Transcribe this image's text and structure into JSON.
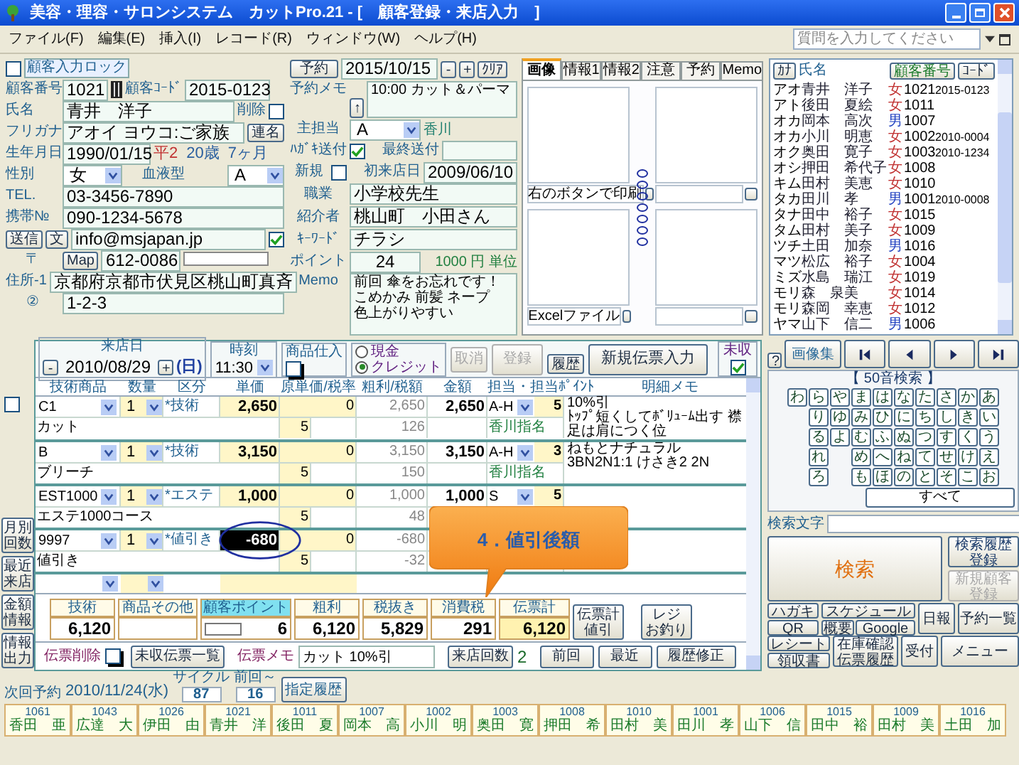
{
  "window": {
    "title": "美容・理容・サロンシステム　カットPro.21 - [　顧客登録・来店入力　]"
  },
  "menu": [
    "ファイル(F)",
    "編集(E)",
    "挿入(I)",
    "レコード(R)",
    "ウィンドウ(W)",
    "ヘルプ(H)"
  ],
  "help_search": {
    "placeholder": "質問を入力してください"
  },
  "customer": {
    "lock": {
      "label": "顧客入力ロック",
      "checked": false
    },
    "number_label": "顧客番号",
    "number": "1021",
    "code_label": "顧客ｺｰﾄﾞ",
    "code": "2015-0123",
    "name_label": "氏名",
    "name": "青井　洋子",
    "delete_label": "削除",
    "deleted": false,
    "kana_label": "フリガナ",
    "kana": "アオイ ヨウコ:ご家族",
    "joint_button": "連名",
    "birth_label": "生年月日",
    "birth": "1990/01/15",
    "era": "平2",
    "age": "20歳",
    "months": "7ヶ月",
    "sex_label": "性別",
    "sex": "女",
    "blood_label": "血液型",
    "blood": "A",
    "tel_label": "TEL.",
    "tel": "03-3456-7890",
    "mobile_label": "携帯№",
    "mobile": "090-1234-5678",
    "send_button": "送信",
    "text_button": "文",
    "email": "info@msjapan.jp",
    "email_ok": true,
    "zip_label": "〒",
    "map_button": "Map",
    "zip": "612-0086",
    "address1_label": "住所-1",
    "address1": "京都府京都市伏見区桃山町真斉",
    "address2_label": "②",
    "address2": "1-2-3"
  },
  "reservation": {
    "button": "予約",
    "date": "2015/10/15",
    "minus": "-",
    "plus": "+",
    "clear": "ｸﾘｱ",
    "memo_label": "予約メモ",
    "up_button": "↑",
    "memo": "10:00 カット＆パーマ"
  },
  "profile": {
    "staff_label": "主担当",
    "staff": "A",
    "staff_name": "香川",
    "dm_label": "ﾊｶﾞｷ送付",
    "dm": true,
    "last_sent_label": "最終送付",
    "new_label": "新規",
    "is_new": false,
    "first_visit_label": "初来店日",
    "first_visit": "2009/06/10",
    "job_label": "職業",
    "job": "小学校先生",
    "referrer_label": "紹介者",
    "referrer": "桃山町　小田さん",
    "keyword_label": "ｷｰﾜｰﾄﾞ",
    "keyword": "チラシ",
    "points_label": "ポイント",
    "points": "24",
    "point_unit": "1000 円 単位",
    "memo_label": "Memo",
    "memo": [
      "前回 傘をお忘れです！",
      "こめかみ 前髪 ネープ",
      "色上がりやすい"
    ]
  },
  "image_panel": {
    "tabs": [
      {
        "label": "画像",
        "selected": true
      },
      {
        "label": "情報1",
        "selected": false
      },
      {
        "label": "情報2",
        "selected": false
      },
      {
        "label": "注意",
        "selected": false
      },
      {
        "label": "予約",
        "selected": false
      },
      {
        "label": "Memo",
        "selected": false
      }
    ],
    "captions": [
      "右のボタンで印刷",
      "Excelファイル"
    ]
  },
  "customer_list": {
    "kana_button": "ｶﾅ",
    "name_label": "氏名",
    "number_button": "顧客番号",
    "code_button": "ｺｰﾄﾞ",
    "rows": [
      {
        "kana": "アオ",
        "name": "青井　洋子",
        "sex": "女",
        "color": "#c03030",
        "number": "1021",
        "code": "2015-0123"
      },
      {
        "kana": "アト",
        "name": "後田　夏絵",
        "sex": "女",
        "color": "#c03030",
        "number": "1011"
      },
      {
        "kana": "オカ",
        "name": "岡本　高次",
        "sex": "男",
        "color": "#2040c0",
        "number": "1007"
      },
      {
        "kana": "オカ",
        "name": "小川　明恵",
        "sex": "女",
        "color": "#c03030",
        "number": "1002",
        "code": "2010-0004"
      },
      {
        "kana": "オク",
        "name": "奥田　寛子",
        "sex": "女",
        "color": "#c03030",
        "number": "1003",
        "code": "2010-1234"
      },
      {
        "kana": "オシ",
        "name": "押田　希代子",
        "sex": "女",
        "color": "#c03030",
        "number": "1008"
      },
      {
        "kana": "キム",
        "name": "田村　美恵",
        "sex": "女",
        "color": "#c03030",
        "number": "1010"
      },
      {
        "kana": "タカ",
        "name": "田川　孝",
        "sex": "男",
        "color": "#2040c0",
        "number": "1001",
        "code": "2010-0008"
      },
      {
        "kana": "タナ",
        "name": "田中　裕子",
        "sex": "女",
        "color": "#c03030",
        "number": "1015"
      },
      {
        "kana": "タム",
        "name": "田村　美子",
        "sex": "女",
        "color": "#c03030",
        "number": "1009"
      },
      {
        "kana": "ツチ",
        "name": "土田　加奈",
        "sex": "男",
        "color": "#2040c0",
        "number": "1016"
      },
      {
        "kana": "マツ",
        "name": "松広　裕子",
        "sex": "女",
        "color": "#c03030",
        "number": "1004"
      },
      {
        "kana": "ミズ",
        "name": "水島　瑞江",
        "sex": "女",
        "color": "#c03030",
        "number": "1019"
      },
      {
        "kana": "モリ",
        "name": "森　泉美",
        "sex": "女",
        "color": "#c03030",
        "number": "1014"
      },
      {
        "kana": "モリ",
        "name": "森岡　幸恵",
        "sex": "女",
        "color": "#c03030",
        "number": "1012"
      },
      {
        "kana": "ヤマ",
        "name": "山下　信二",
        "sex": "男",
        "color": "#2040c0",
        "number": "1006"
      }
    ]
  },
  "side_buttons": [
    "月別回数",
    "最近来店",
    "金額情報",
    "情報出力"
  ],
  "slip": {
    "date_label": "来店日",
    "prev": "-",
    "date": "2010/08/29",
    "next": "+",
    "weekday": "(日)",
    "time_label": "時刻",
    "time": "11:30",
    "goods_label": "商品仕入",
    "goods": false,
    "payments": [
      {
        "label": "現金",
        "selected": false
      },
      {
        "label": "クレジット",
        "selected": true
      }
    ],
    "cancel": {
      "label": "取消",
      "disabled": true
    },
    "register": {
      "label": "登録",
      "disabled": true
    },
    "history_button": "履歴",
    "new_slip_button": "新規伝票入力",
    "unpaid_label": "未収",
    "unpaid": true,
    "line_check": false,
    "columns": [
      "技術商品",
      "数量",
      "区分",
      "単価",
      "原単価/税率",
      "粗利/税額",
      "金額",
      "担当・担当ﾎﾟｲﾝﾄ",
      "明細メモ"
    ],
    "lines": [
      {
        "code": "C1",
        "qty": "1",
        "category": "*技術",
        "price": "2,650",
        "price_selected": false,
        "cost": "0",
        "profit": "2,650",
        "amount": "2,650",
        "staff": "A-H",
        "staff_point": "5",
        "name": "カット",
        "tax_rate": "5",
        "tax": "126",
        "staff_name": "香川指名",
        "memo": [
          "10%引",
          "ﾄｯﾌﾟ短くしてﾎﾞﾘｭｰﾑ出す 襟足は肩につく位"
        ]
      },
      {
        "code": "B",
        "qty": "1",
        "category": "*技術",
        "price": "3,150",
        "price_selected": false,
        "cost": "0",
        "profit": "3,150",
        "amount": "3,150",
        "staff": "A-H",
        "staff_point": "3",
        "name": "ブリーチ",
        "tax_rate": "5",
        "tax": "150",
        "staff_name": "香川指名",
        "memo": [
          "ねもとナチュラル3BN2N1:1 けさき2 2N"
        ]
      },
      {
        "code": "EST1000",
        "qty": "1",
        "category": "*エステ",
        "price": "1,000",
        "price_selected": false,
        "cost": "0",
        "profit": "1,000",
        "amount": "1,000",
        "staff": "S",
        "staff_point": "5",
        "name": "エステ1000コース",
        "tax_rate": "5",
        "tax": "48"
      },
      {
        "code": "9997",
        "qty": "1",
        "category": "*値引き",
        "price": "-680",
        "price_selected": true,
        "cost": "0",
        "profit": "-680",
        "name": "値引き",
        "tax_rate": "5",
        "tax": "-32"
      }
    ],
    "totals": [
      {
        "kind": "plain",
        "label": "技術",
        "value": "6,120"
      },
      {
        "kind": "plain",
        "label": "商品その他"
      },
      {
        "kind": "points",
        "label": "顧客ポイント",
        "value": "6"
      },
      {
        "kind": "plain",
        "label": "粗利",
        "value": "6,120"
      },
      {
        "kind": "plain",
        "label": "税抜き",
        "value": "5,829"
      },
      {
        "kind": "plain",
        "label": "消費税",
        "value": "291"
      },
      {
        "kind": "total",
        "label": "伝票計",
        "value": "6,120"
      }
    ],
    "discount_button": "伝票計値引",
    "change_button": [
      "レジ",
      "お釣り"
    ],
    "delete_label": "伝票削除",
    "delete": false,
    "unpaid_list_button": "未収伝票一覧",
    "memo_label": "伝票メモ",
    "memo": "カット 10%引",
    "visits_button": "来店回数",
    "visits": "2",
    "prev_button": "前回",
    "recent_button": "最近",
    "edit_button": "履歴修正"
  },
  "callout": "4．値引後額",
  "search_panel": {
    "help_button": "?",
    "gallery_button": "画像集",
    "title": "【 50音検索 】",
    "kana_rows": [
      {
        "keys": [
          "わ",
          "ら",
          "や",
          "ま",
          "は",
          "な",
          "た",
          "さ",
          "か",
          "あ"
        ]
      },
      {
        "keys": [
          "り",
          "ゆ",
          "み",
          "ひ",
          "に",
          "ち",
          "し",
          "き",
          "い"
        ]
      },
      {
        "keys": [
          "る",
          "よ",
          "む",
          "ふ",
          "ぬ",
          "つ",
          "す",
          "く",
          "う"
        ]
      },
      {
        "lead": "れ",
        "keys": [
          "め",
          "へ",
          "ね",
          "て",
          "せ",
          "け",
          "え"
        ]
      },
      {
        "lead": "ろ",
        "keys": [
          "も",
          "ほ",
          "の",
          "と",
          "そ",
          "こ",
          "お"
        ]
      }
    ],
    "all_button": "すべて",
    "search_label": "検索文字",
    "search_button": "検索",
    "history_button": "検索履歴登録",
    "new_button": {
      "label": "新規顧客登録",
      "disabled": true
    }
  },
  "tools": {
    "postcard": "ハガキ",
    "qr": "QR",
    "schedule": "スケジュール",
    "overview": "概要",
    "google": "Google",
    "daily": "日報",
    "reservations": "予約一覧",
    "receipt": "レシート",
    "invoice": "領収書",
    "stock": "在庫確認伝票履歴",
    "reception": "受付",
    "menu": "メニュー"
  },
  "next_visit": {
    "label": "次回予約",
    "date": "2010/11/24(水)",
    "cycle_label": "サイクル",
    "cycle": "87",
    "since_label": "前回～",
    "since": "16",
    "history_button": "指定履歴"
  },
  "history": [
    {
      "number": "1061",
      "name": "香田　亜"
    },
    {
      "number": "1043",
      "name": "広達　大"
    },
    {
      "number": "1026",
      "name": "伊田　由"
    },
    {
      "number": "1021",
      "name": "青井　洋"
    },
    {
      "number": "1011",
      "name": "後田　夏"
    },
    {
      "number": "1007",
      "name": "岡本　高"
    },
    {
      "number": "1002",
      "name": "小川　明"
    },
    {
      "number": "1003",
      "name": "奥田　寛"
    },
    {
      "number": "1008",
      "name": "押田　希"
    },
    {
      "number": "1010",
      "name": "田村　美"
    },
    {
      "number": "1001",
      "name": "田川　孝"
    },
    {
      "number": "1006",
      "name": "山下　信"
    },
    {
      "number": "1015",
      "name": "田中　裕"
    },
    {
      "number": "1009",
      "name": "田村　美"
    },
    {
      "number": "1016",
      "name": "土田　加"
    }
  ]
}
